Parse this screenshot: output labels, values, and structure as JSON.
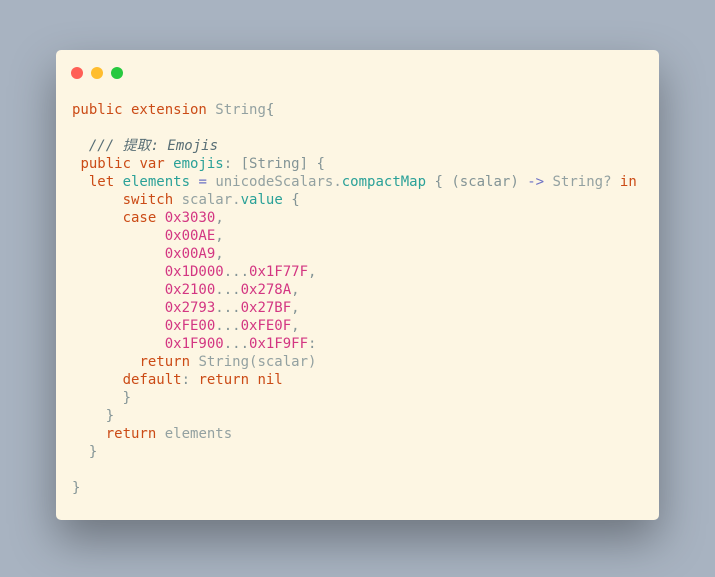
{
  "window": {
    "colors": {
      "close": "#ff5f56",
      "minimize": "#ffbd2e",
      "zoom": "#27c93f"
    }
  },
  "code": {
    "lines": [
      [
        [
          "kw",
          "public extension "
        ],
        [
          "ty",
          "String"
        ],
        [
          "pl",
          "{"
        ]
      ],
      [],
      [
        [
          "pl",
          "  "
        ],
        [
          "cm",
          "/// 提取: Emojis"
        ]
      ],
      [
        [
          "pl",
          " "
        ],
        [
          "kw",
          "public var "
        ],
        [
          "id",
          "emojis"
        ],
        [
          "pl",
          ": [String] {"
        ]
      ],
      [
        [
          "pl",
          "  "
        ],
        [
          "kw",
          "let "
        ],
        [
          "id",
          "elements"
        ],
        [
          "op",
          " = "
        ],
        [
          "ty",
          "unicodeScalars."
        ],
        [
          "id",
          "compactMap"
        ],
        [
          "pl",
          " { (scalar) "
        ],
        [
          "op",
          "->"
        ],
        [
          "ty",
          " String? "
        ],
        [
          "kw",
          "in"
        ]
      ],
      [
        [
          "pl",
          "      "
        ],
        [
          "kw",
          "switch "
        ],
        [
          "ty",
          "scalar."
        ],
        [
          "id",
          "value"
        ],
        [
          "pl",
          " {"
        ]
      ],
      [
        [
          "pl",
          "      "
        ],
        [
          "kw",
          "case "
        ],
        [
          "num",
          "0x3030"
        ],
        [
          "pl",
          ","
        ]
      ],
      [
        [
          "pl",
          "           "
        ],
        [
          "num",
          "0x00AE"
        ],
        [
          "pl",
          ","
        ]
      ],
      [
        [
          "pl",
          "           "
        ],
        [
          "num",
          "0x00A9"
        ],
        [
          "pl",
          ","
        ]
      ],
      [
        [
          "pl",
          "           "
        ],
        [
          "num",
          "0x1D000"
        ],
        [
          "pl",
          "..."
        ],
        [
          "num",
          "0x1F77F"
        ],
        [
          "pl",
          ","
        ]
      ],
      [
        [
          "pl",
          "           "
        ],
        [
          "num",
          "0x2100"
        ],
        [
          "pl",
          "..."
        ],
        [
          "num",
          "0x278A"
        ],
        [
          "pl",
          ","
        ]
      ],
      [
        [
          "pl",
          "           "
        ],
        [
          "num",
          "0x2793"
        ],
        [
          "pl",
          "..."
        ],
        [
          "num",
          "0x27BF"
        ],
        [
          "pl",
          ","
        ]
      ],
      [
        [
          "pl",
          "           "
        ],
        [
          "num",
          "0xFE00"
        ],
        [
          "pl",
          "..."
        ],
        [
          "num",
          "0xFE0F"
        ],
        [
          "pl",
          ","
        ]
      ],
      [
        [
          "pl",
          "           "
        ],
        [
          "num",
          "0x1F900"
        ],
        [
          "pl",
          "..."
        ],
        [
          "num",
          "0x1F9FF"
        ],
        [
          "pl",
          ":"
        ]
      ],
      [
        [
          "pl",
          "        "
        ],
        [
          "kw",
          "return "
        ],
        [
          "ty",
          "String(scalar)"
        ]
      ],
      [
        [
          "pl",
          "      "
        ],
        [
          "kw",
          "default"
        ],
        [
          "pl",
          ": "
        ],
        [
          "kw",
          "return nil"
        ]
      ],
      [
        [
          "pl",
          "      }"
        ]
      ],
      [
        [
          "pl",
          "    }"
        ]
      ],
      [
        [
          "pl",
          "    "
        ],
        [
          "kw",
          "return "
        ],
        [
          "ty",
          "elements"
        ]
      ],
      [
        [
          "pl",
          "  }"
        ]
      ],
      [],
      [
        [
          "pl",
          "}"
        ]
      ]
    ]
  }
}
